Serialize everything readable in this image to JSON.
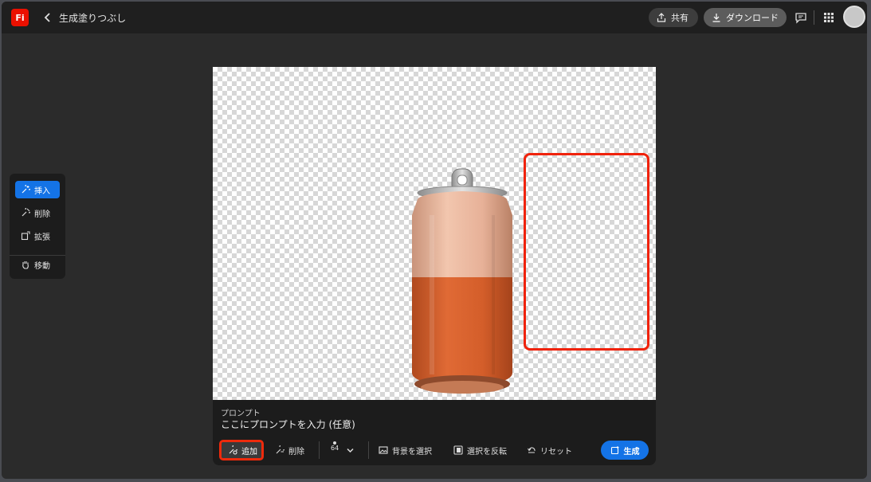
{
  "header": {
    "logo_text": "Fi",
    "back_icon": "chevron-left-icon",
    "title": "生成塗りつぶし",
    "share_label": "共有",
    "download_label": "ダウンロード",
    "comment_icon": "comment-icon",
    "apps_icon": "apps-grid-icon",
    "avatar": "avatar"
  },
  "tools": {
    "items": [
      {
        "label": "挿入",
        "icon": "insert-icon",
        "active": true
      },
      {
        "label": "削除",
        "icon": "remove-icon",
        "active": false
      },
      {
        "label": "拡張",
        "icon": "expand-icon",
        "active": false
      },
      {
        "label": "移動",
        "icon": "hand-icon",
        "active": false
      }
    ]
  },
  "prompt": {
    "label": "プロンプト",
    "placeholder": "ここにプロンプトを入力 (任意)",
    "add_label": "追加",
    "remove_label": "削除",
    "brush_size": "64",
    "select_bg_label": "背景を選択",
    "invert_label": "選択を反転",
    "reset_label": "リセット",
    "generate_label": "生成"
  },
  "colors": {
    "accent": "#1473e6",
    "selection": "#f0220a",
    "brand": "#eb1000"
  }
}
